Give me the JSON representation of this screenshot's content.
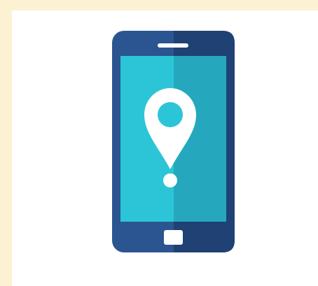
{
  "illustration": {
    "subject": "smartphone-location-pin",
    "icons": [
      "smartphone-icon",
      "location-pin-icon"
    ]
  },
  "colors": {
    "page_background": "#fcf1d2",
    "card_background": "#ffffff",
    "phone_body": "#2b5590",
    "phone_body_shade": "#1f4174",
    "screen_light": "#2cc5d7",
    "screen_dark": "#25a8bd",
    "pin": "#ffffff",
    "pin_center": "#2cc5d7"
  }
}
